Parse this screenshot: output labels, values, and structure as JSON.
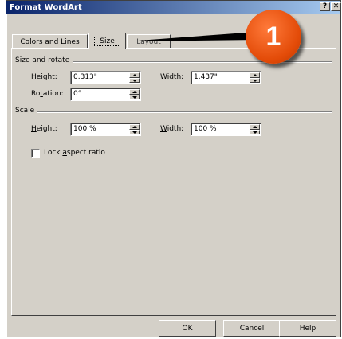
{
  "window": {
    "title": "Format WordArt",
    "help_button": "?",
    "close_button": "✕"
  },
  "tabs": [
    {
      "label": "Colors and Lines"
    },
    {
      "label": "Size"
    },
    {
      "label": "Layout"
    }
  ],
  "size_rotate": {
    "section_title": "Size and rotate",
    "height_label_pre": "H",
    "height_label_ul": "e",
    "height_label_post": "ight:",
    "height_value": "0.313\"",
    "width_label_pre": "Wi",
    "width_label_ul": "d",
    "width_label_post": "th:",
    "width_value": "1.437\"",
    "rotation_label_pre": "Ro",
    "rotation_label_ul": "t",
    "rotation_label_post": "ation:",
    "rotation_value": "0°"
  },
  "scale": {
    "section_title": "Scale",
    "height_label_pre": "",
    "height_label_ul": "H",
    "height_label_post": "eight:",
    "height_value": "100 %",
    "width_label_pre": "",
    "width_label_ul": "W",
    "width_label_post": "idth:",
    "width_value": "100 %",
    "lock_label_pre": "Lock ",
    "lock_label_ul": "a",
    "lock_label_post": "spect ratio",
    "lock_checked": false
  },
  "buttons": {
    "ok": "OK",
    "cancel": "Cancel",
    "help": "Help"
  },
  "callout": {
    "number": "1",
    "color": "#e34b08"
  }
}
